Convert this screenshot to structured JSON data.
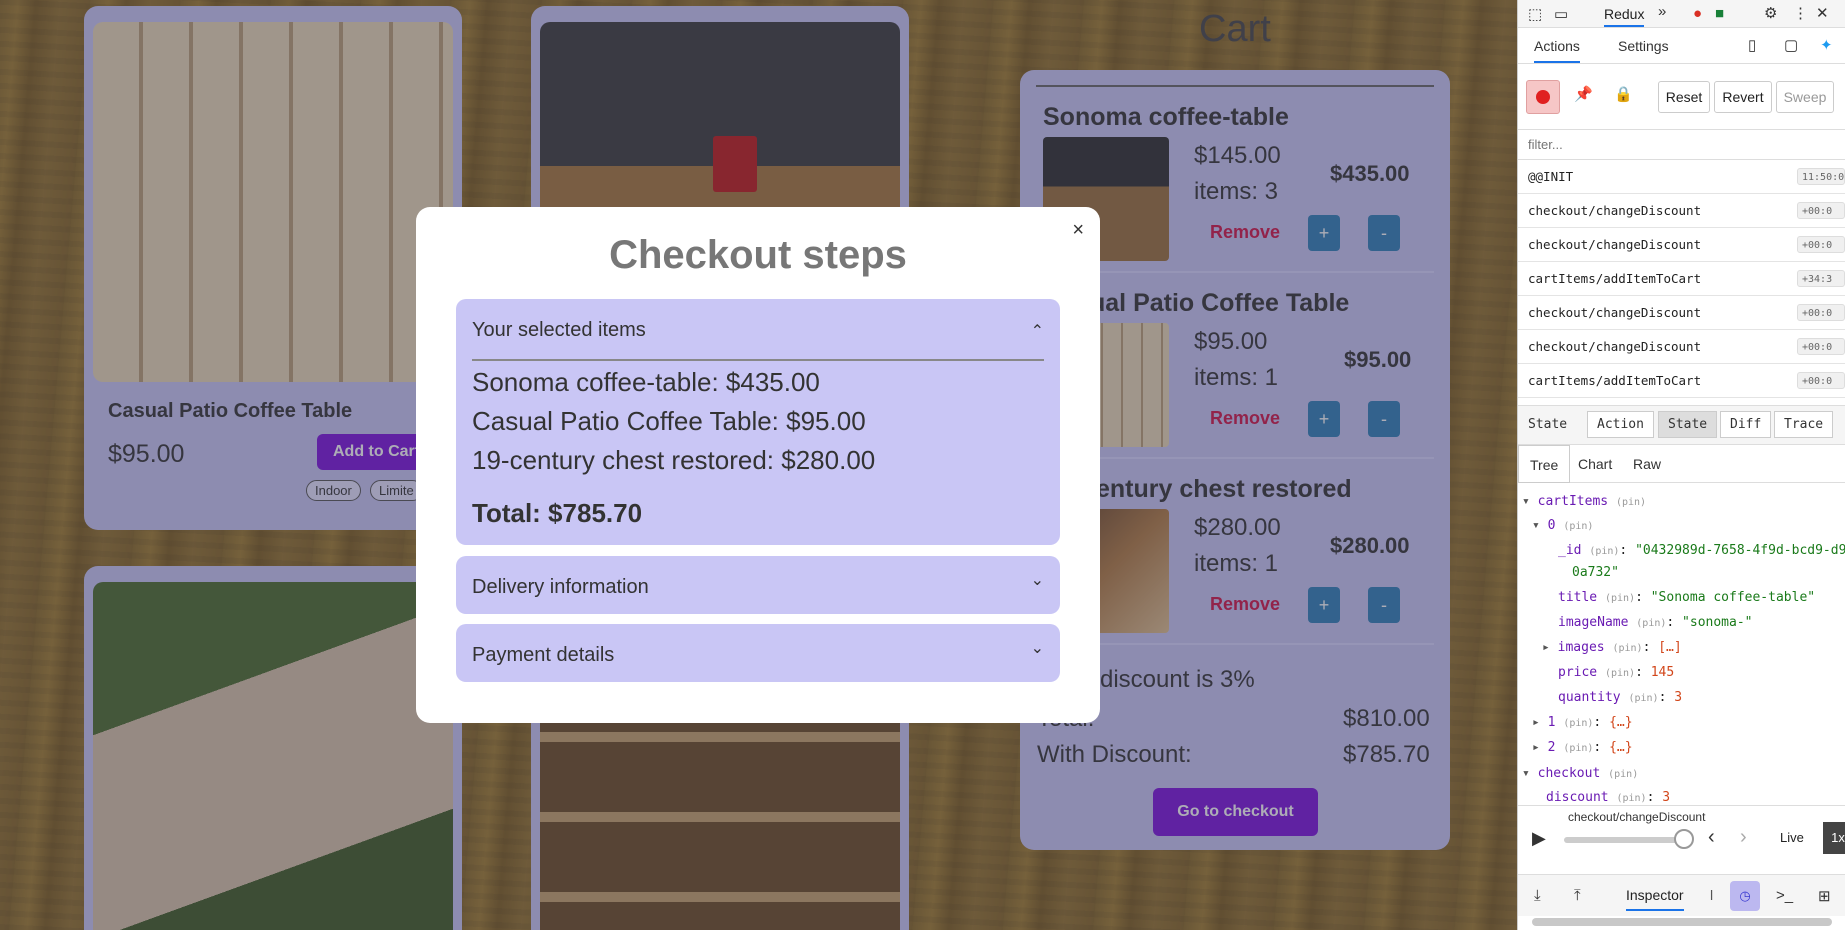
{
  "products": [
    {
      "title": "Casual Patio Coffee Table",
      "price": "$95.00",
      "button": "Add to Cart",
      "tags": [
        "Indoor",
        "Limite"
      ]
    }
  ],
  "cart": {
    "title": "Cart",
    "items": [
      {
        "title": "Sonoma coffee-table",
        "price": "$145.00",
        "qty": "items: 3",
        "total": "$435.00",
        "remove": "Remove",
        "plus": "+",
        "minus": "-"
      },
      {
        "title": "ual Patio Coffee Table",
        "price": "$95.00",
        "qty": "items: 1",
        "total": "$95.00",
        "remove": "Remove",
        "plus": "+",
        "minus": "-"
      },
      {
        "title": "entury chest restored",
        "price": "$280.00",
        "qty": "items: 1",
        "total": "$280.00",
        "remove": "Remove",
        "plus": "+",
        "minus": "-"
      }
    ],
    "discount_text": "discount is 3%",
    "total_label": "Total:",
    "total_value": "$810.00",
    "with_discount_label": "With Discount:",
    "with_discount_value": "$785.70",
    "checkout_button": "Go to checkout"
  },
  "modal": {
    "close": "×",
    "title": "Checkout steps",
    "sections": [
      {
        "label": "Your selected items",
        "chevron": "⌃",
        "expanded": true,
        "lines": [
          "Sonoma coffee-table: $435.00",
          "Casual Patio Coffee Table: $95.00",
          "19-century chest restored: $280.00"
        ],
        "total": "Total: $785.70"
      },
      {
        "label": "Delivery information",
        "chevron": "⌄",
        "expanded": false
      },
      {
        "label": "Payment details",
        "chevron": "⌄",
        "expanded": false
      }
    ]
  },
  "devtools": {
    "redux_label": "Redux",
    "tabs": {
      "actions": "Actions",
      "settings": "Settings"
    },
    "toolbar": {
      "reset": "Reset",
      "revert": "Revert",
      "sweep": "Sweep"
    },
    "filter_placeholder": "filter...",
    "actions": [
      {
        "name": "@@INIT",
        "time": "11:50:0"
      },
      {
        "name": "checkout/changeDiscount",
        "time": "+00:0"
      },
      {
        "name": "checkout/changeDiscount",
        "time": "+00:0"
      },
      {
        "name": "cartItems/addItemToCart",
        "time": "+34:3"
      },
      {
        "name": "checkout/changeDiscount",
        "time": "+00:0"
      },
      {
        "name": "checkout/changeDiscount",
        "time": "+00:0"
      },
      {
        "name": "cartItems/addItemToCart",
        "time": "+00:0"
      }
    ],
    "inspector_tabs": [
      "State",
      "Action",
      "State",
      "Diff",
      "Trace"
    ],
    "view_tabs": [
      "Tree",
      "Chart",
      "Raw"
    ],
    "tree": {
      "cartItems": "cartItems",
      "pin": "(pin)",
      "i0": "0",
      "id_key": "_id",
      "id_val": "\"0432989d-7658-4f9d-bcd9-d9",
      "id_val2": "0a732\"",
      "title_key": "title",
      "title_val": "\"Sonoma coffee-table\"",
      "imageName_key": "imageName",
      "imageName_val": "\"sonoma-\"",
      "images_key": "images",
      "images_val": "[…]",
      "price_key": "price",
      "price_val": "145",
      "quantity_key": "quantity",
      "quantity_val": "3",
      "i1": "1",
      "i2": "2",
      "obj": "{…}",
      "checkout": "checkout",
      "discount_key": "discount",
      "discount_val": "3"
    },
    "slider_label": "checkout/changeDiscount",
    "live": "Live",
    "speed": "1x",
    "bottom_tab": "Inspector",
    "bottom_l": "l"
  }
}
